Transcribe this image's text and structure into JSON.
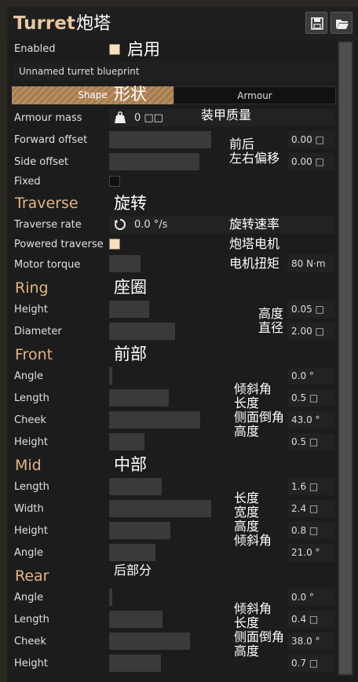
{
  "window": {
    "title": "Turret",
    "title_zh": "炮塔"
  },
  "toolbar": {
    "save_icon": "save-icon",
    "open_icon": "open-folder-icon"
  },
  "enabled": {
    "label": "Enabled",
    "checked": true,
    "zh": "启用"
  },
  "blueprint_name": "Unnamed turret blueprint",
  "tabs": {
    "shape": "Shape",
    "shape_zh": "形状",
    "armour": "Armour",
    "active": "Shape"
  },
  "general": {
    "armour_mass": {
      "label": "Armour mass",
      "value": "0 □□",
      "zh": "装甲质量"
    },
    "forward_offset": {
      "label": "Forward offset",
      "value": "0.00 □",
      "zh": "前后"
    },
    "side_offset": {
      "label": "Side offset",
      "value": "0.00 □",
      "zh": "左右偏移"
    },
    "fixed": {
      "label": "Fixed",
      "checked": false
    }
  },
  "traverse": {
    "title": "Traverse",
    "title_zh": "旋转",
    "rate": {
      "label": "Traverse rate",
      "value": "0.0 °/s",
      "zh": "旋转速率"
    },
    "powered": {
      "label": "Powered traverse",
      "checked": true,
      "zh": "炮塔电机"
    },
    "torque": {
      "label": "Motor torque",
      "value": "80 N·m",
      "zh": "电机扭矩"
    }
  },
  "ring": {
    "title": "Ring",
    "title_zh": "座圈",
    "height": {
      "label": "Height",
      "value": "0.05 □",
      "zh": "高度"
    },
    "diameter": {
      "label": "Diameter",
      "value": "2.00 □",
      "zh": "直径"
    }
  },
  "front": {
    "title": "Front",
    "title_zh": "前部",
    "angle": {
      "label": "Angle",
      "value": "0.0 °",
      "zh": "倾斜角"
    },
    "length": {
      "label": "Length",
      "value": "0.5 □",
      "zh": "长度"
    },
    "cheek": {
      "label": "Cheek",
      "value": "43.0 °",
      "zh": "侧面倒角"
    },
    "height": {
      "label": "Height",
      "value": "0.5 □",
      "zh": "高度"
    }
  },
  "mid": {
    "title": "Mid",
    "title_zh": "中部",
    "length": {
      "label": "Length",
      "value": "1.6 □",
      "zh": "长度"
    },
    "width": {
      "label": "Width",
      "value": "2.4 □",
      "zh": "宽度"
    },
    "height": {
      "label": "Height",
      "value": "0.8 □",
      "zh": "高度"
    },
    "angle": {
      "label": "Angle",
      "value": "21.0 °",
      "zh": "倾斜角"
    }
  },
  "rear": {
    "title": "Rear",
    "title_zh": "后部分",
    "angle": {
      "label": "Angle",
      "value": "0.0 °",
      "zh": "倾斜角"
    },
    "length": {
      "label": "Length",
      "value": "0.4 □",
      "zh": "长度"
    },
    "cheek": {
      "label": "Cheek",
      "value": "38.0 °",
      "zh": "侧面倒角"
    },
    "height": {
      "label": "Height",
      "value": "0.7 □",
      "zh": "高度"
    }
  },
  "colors": {
    "accent": "#e4b486",
    "tab_active": "#b98c5e",
    "checkbox_on": "#f6dfc0"
  }
}
